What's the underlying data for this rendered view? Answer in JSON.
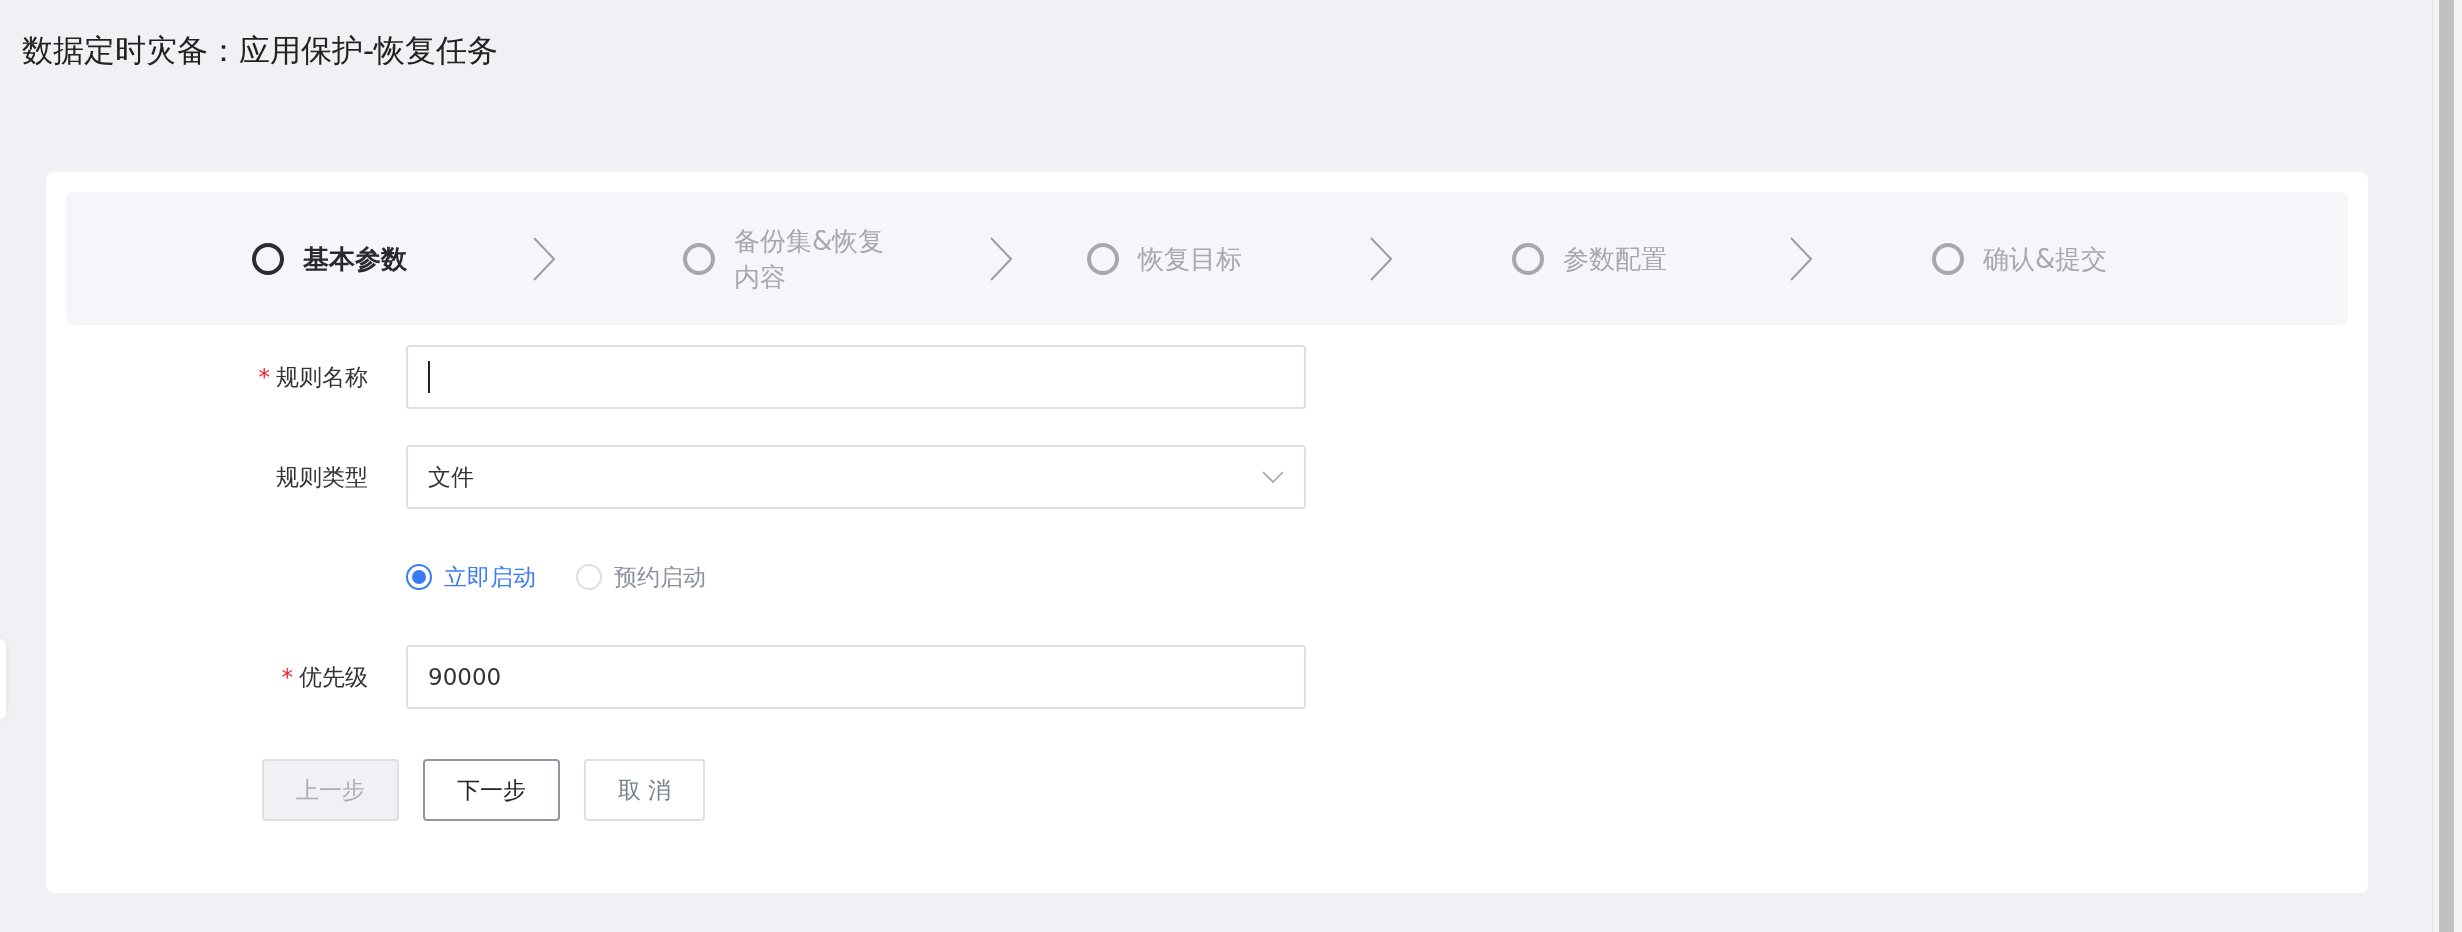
{
  "page_title": "数据定时灾备：应用保护-恢复任务",
  "steps": [
    {
      "label": "基本参数",
      "selected": true
    },
    {
      "label": "备份集&恢复内容",
      "selected": false
    },
    {
      "label": "恢复目标",
      "selected": false
    },
    {
      "label": "参数配置",
      "selected": false
    },
    {
      "label": "确认&提交",
      "selected": false
    }
  ],
  "form": {
    "fields": [
      {
        "kind": "text",
        "required_mark": "*",
        "label": "规则名称",
        "focused": true
      },
      {
        "kind": "select",
        "label": "规则类型",
        "value": "文件"
      },
      {
        "kind": "radio",
        "options": [
          {
            "label": "立即启动",
            "selected": true
          },
          {
            "label": "预约启动",
            "selected": false
          }
        ]
      },
      {
        "kind": "text",
        "required_mark": "*",
        "label": "优先级",
        "focused": false,
        "value": "90000"
      }
    ],
    "buttons": [
      {
        "label": "上一步",
        "kind": "disabled"
      },
      {
        "label": "下一步",
        "kind": "emphasis"
      },
      {
        "label": "取 消",
        "kind": "plain"
      }
    ]
  }
}
